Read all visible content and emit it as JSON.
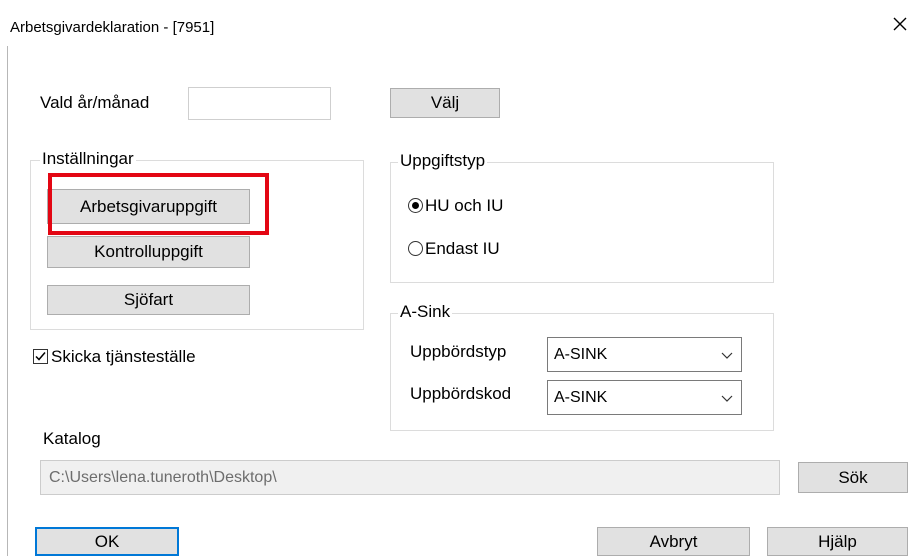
{
  "window": {
    "title": "Arbetsgivardeklaration - [7951]",
    "close_icon": "close-icon"
  },
  "period": {
    "label": "Vald år/månad",
    "value": "",
    "choose_button": "Välj"
  },
  "settings": {
    "legend": "Inställningar",
    "buttons": [
      "Arbetsgivaruppgift",
      "Kontrolluppgift",
      "Sjöfart"
    ],
    "highlight_color": "#e30613"
  },
  "send_workplace": {
    "label": "Skicka tjänsteställe",
    "checked": true
  },
  "report_type": {
    "legend": "Uppgiftstyp",
    "options": [
      "HU och IU",
      "Endast IU"
    ],
    "selected": "HU och IU"
  },
  "a_sink": {
    "legend": "A-Sink",
    "collection_type_label": "Uppbördstyp",
    "collection_type_value": "A-SINK",
    "collection_code_label": "Uppbördskod",
    "collection_code_value": "A-SINK"
  },
  "catalog": {
    "label": "Katalog",
    "path": "C:\\Users\\lena.tuneroth\\Desktop\\",
    "search_button": "Sök"
  },
  "footer": {
    "ok_button": "OK",
    "cancel_button": "Avbryt",
    "help_button": "Hjälp"
  }
}
